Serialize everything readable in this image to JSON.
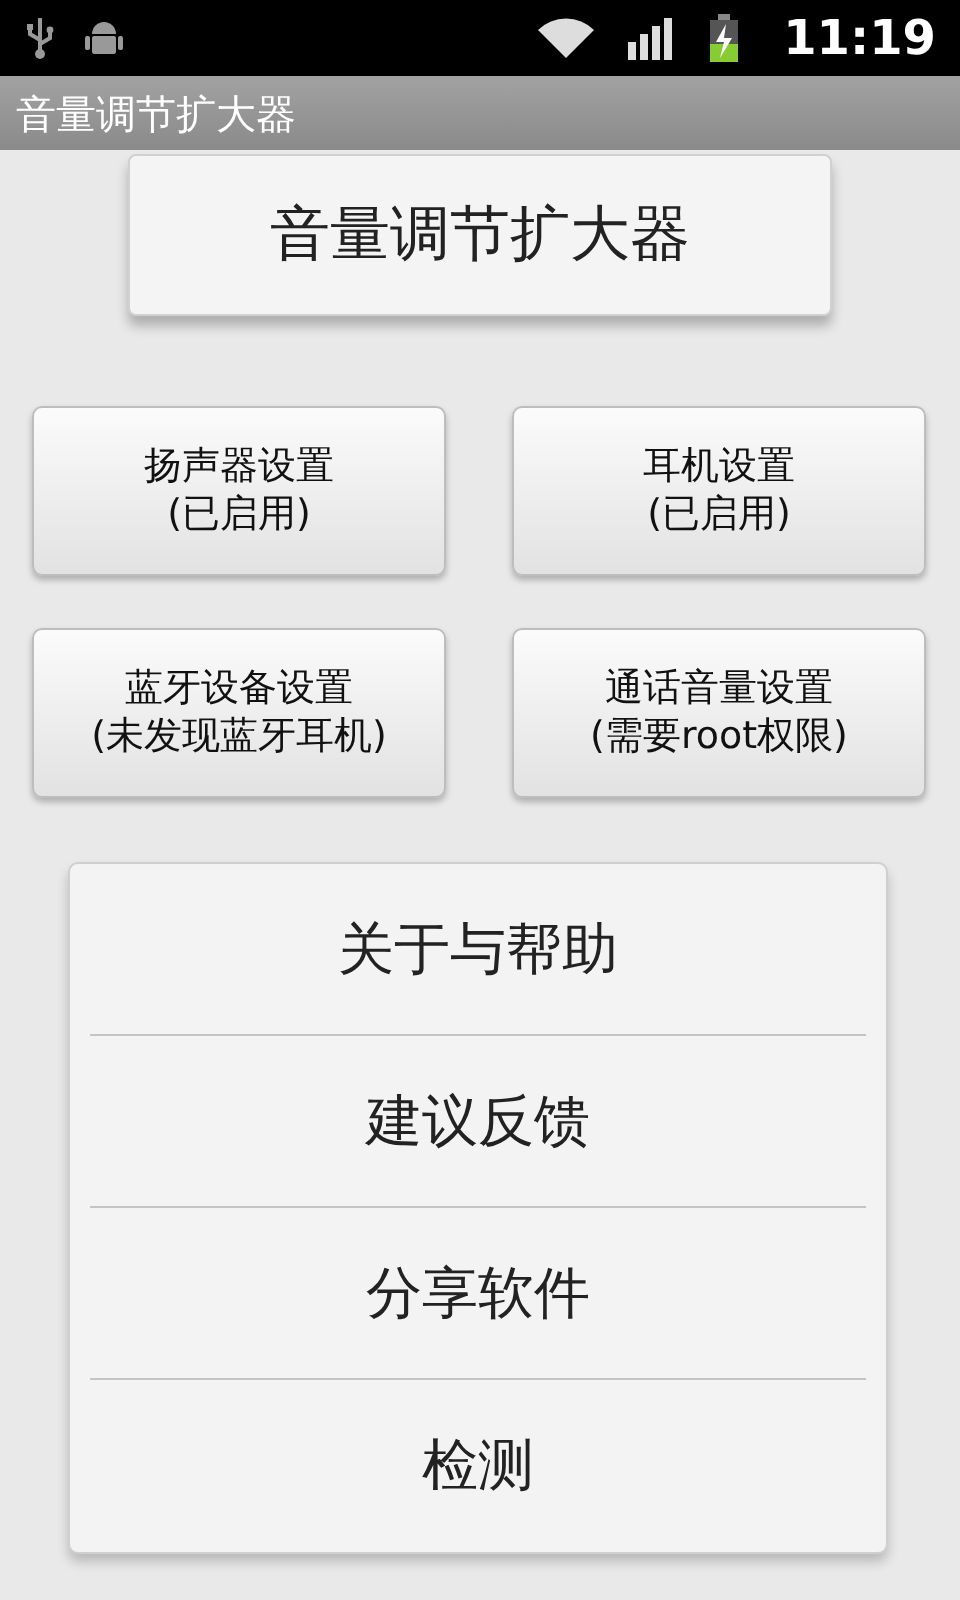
{
  "status_bar": {
    "time": "11:19"
  },
  "window": {
    "title": "音量调节扩大器"
  },
  "header": {
    "title": "音量调节扩大器"
  },
  "buttons": [
    {
      "label": "扬声器设置",
      "status": "(已启用)"
    },
    {
      "label": "耳机设置",
      "status": "(已启用)"
    },
    {
      "label": "蓝牙设备设置",
      "status": "(未发现蓝牙耳机)"
    },
    {
      "label": "通话音量设置",
      "status": "(需要root权限)"
    }
  ],
  "menu": {
    "items": [
      "关于与帮助",
      "建议反馈",
      "分享软件",
      "检测"
    ]
  }
}
